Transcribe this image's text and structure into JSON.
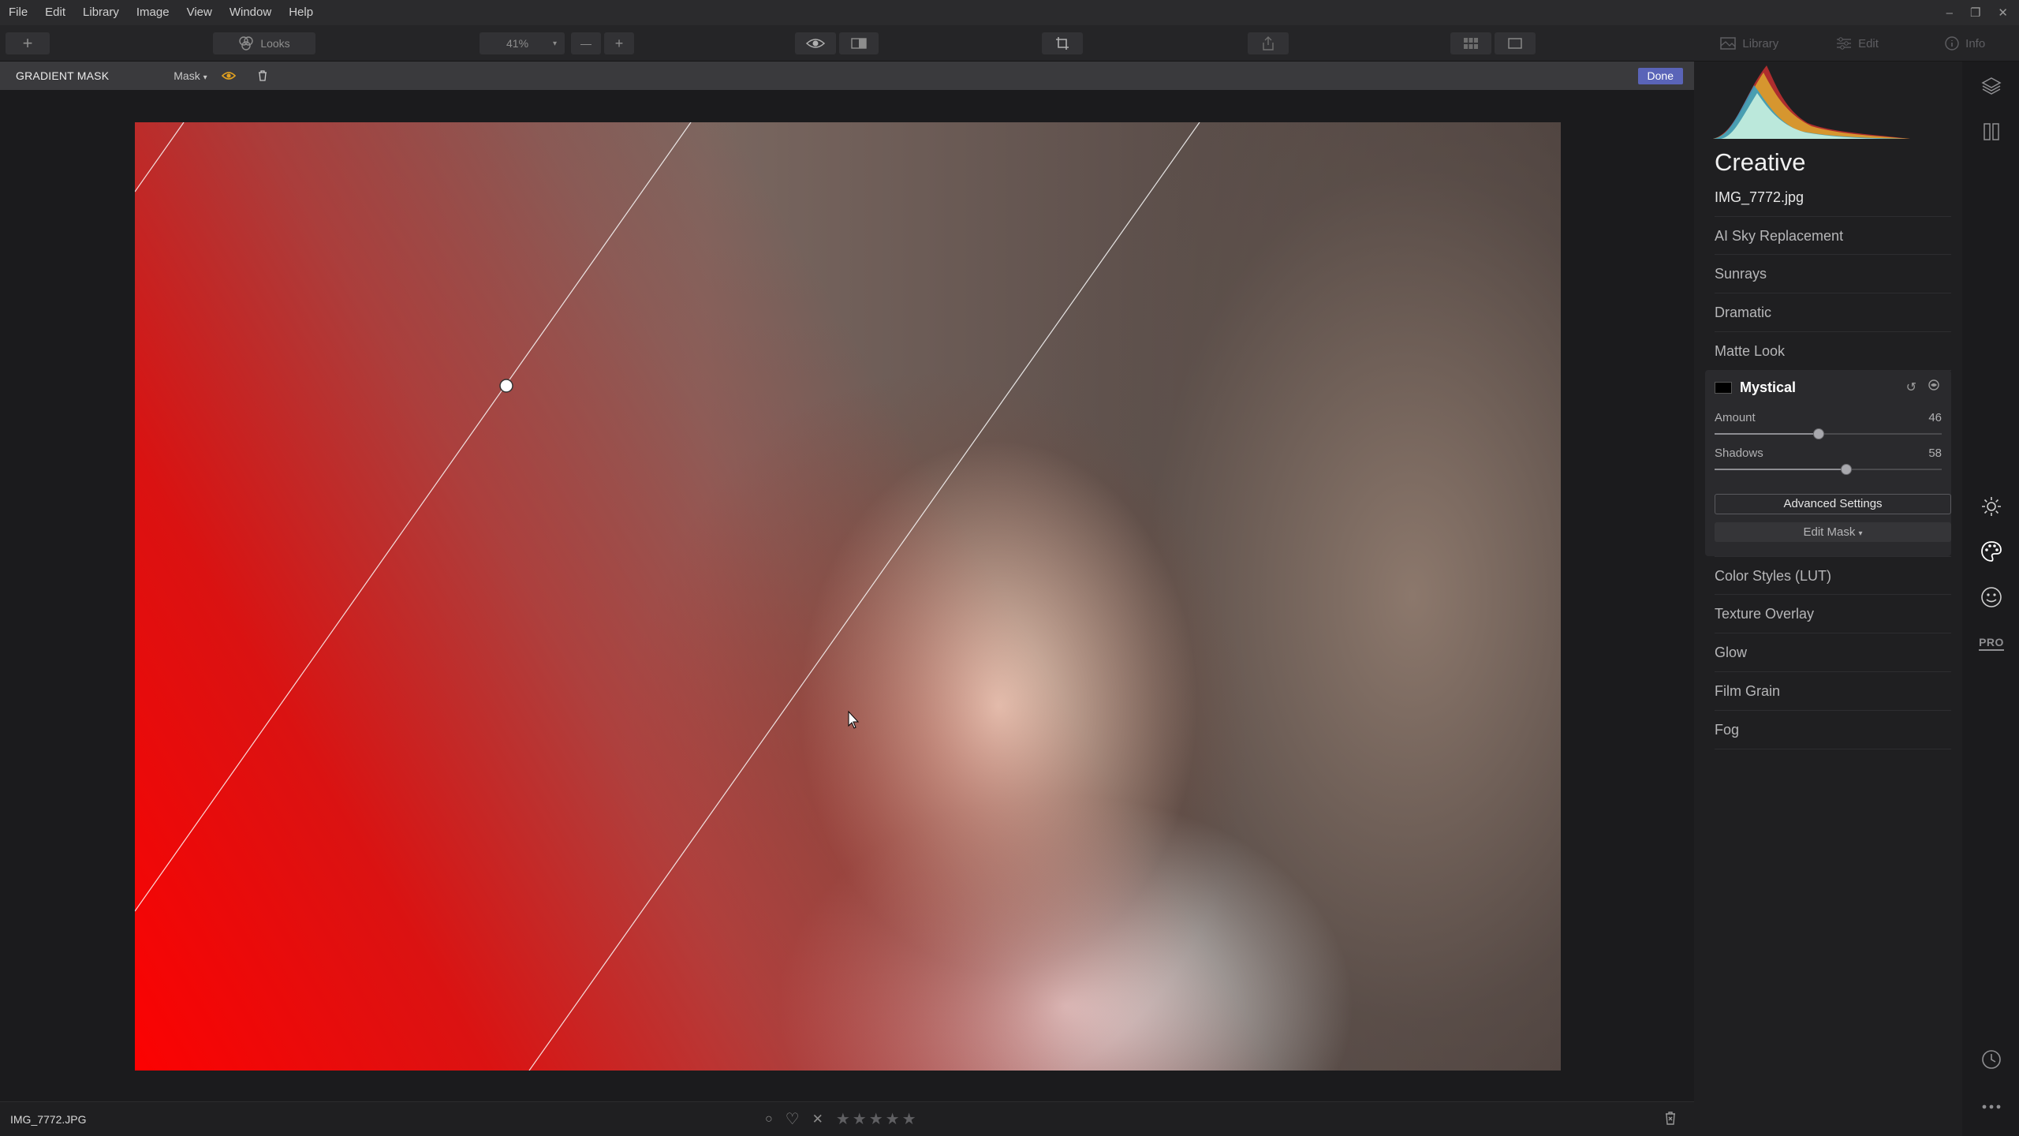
{
  "menu": [
    "File",
    "Edit",
    "Library",
    "Image",
    "View",
    "Window",
    "Help"
  ],
  "window_controls": {
    "minimize": "–",
    "restore": "❐",
    "close": "✕"
  },
  "toolbar": {
    "add_label": "+",
    "looks_label": "Looks",
    "zoom_value": "41%",
    "zoom_out": "—",
    "zoom_in": "+"
  },
  "tabs": [
    {
      "label": "Library",
      "icon": "library-icon"
    },
    {
      "label": "Edit",
      "icon": "sliders-icon"
    },
    {
      "label": "Info",
      "icon": "info-icon"
    }
  ],
  "maskbar": {
    "title": "GRADIENT MASK",
    "mask_dropdown": "Mask",
    "done_label": "Done",
    "accent": "#5a64b8",
    "eye_color": "#e0a020"
  },
  "status": {
    "filename": "IMG_7772.JPG",
    "stars": [
      "★",
      "★",
      "★",
      "★",
      "★"
    ],
    "reject": "✕",
    "favorite": "♡",
    "flag": "○"
  },
  "panel": {
    "title": "Creative",
    "file": "IMG_7772.jpg",
    "items_top": [
      "AI Sky Replacement",
      "Sunrays",
      "Dramatic",
      "Matte Look"
    ],
    "mystical": {
      "title": "Mystical",
      "sliders": [
        {
          "label": "Amount",
          "value": "46",
          "fraction": 0.46
        },
        {
          "label": "Shadows",
          "value": "58",
          "fraction": 0.58
        }
      ],
      "advanced_label": "Advanced Settings",
      "edit_mask_label": "Edit Mask"
    },
    "items_bottom": [
      "Color Styles (LUT)",
      "Texture Overlay",
      "Glow",
      "Film Grain",
      "Fog"
    ]
  },
  "rail": {
    "pro_label": "PRO"
  }
}
